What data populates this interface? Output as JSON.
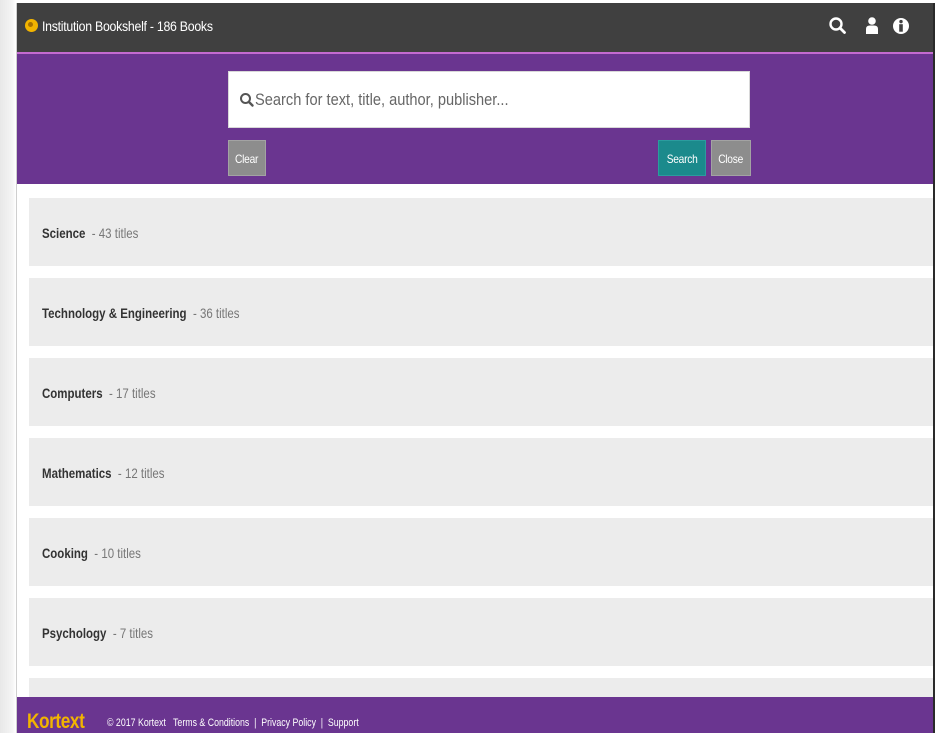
{
  "header": {
    "title": "Institution Bookshelf - 186 Books",
    "icons": [
      "search-icon",
      "user-icon",
      "info-icon"
    ]
  },
  "search": {
    "placeholder": "Search for text, title, author, publisher...",
    "value": "",
    "clear_label": "Clear",
    "search_label": "Search",
    "close_label": "Close"
  },
  "categories": [
    {
      "name": "Science",
      "count": "- 43 titles"
    },
    {
      "name": "Technology & Engineering",
      "count": "- 36 titles"
    },
    {
      "name": "Computers",
      "count": "- 17 titles"
    },
    {
      "name": "Mathematics",
      "count": "- 12 titles"
    },
    {
      "name": "Cooking",
      "count": "- 10 titles"
    },
    {
      "name": "Psychology",
      "count": "- 7 titles"
    }
  ],
  "footer": {
    "brand": "Kortext",
    "copyright": "© 2017 Kortext",
    "terms": "Terms & Conditions",
    "privacy": "Privacy Policy",
    "support": "Support",
    "separator": "|"
  },
  "colors": {
    "topbar": "#404040",
    "brand_purple": "#6a3590",
    "accent_teal": "#1b8a8c",
    "brand_yellow": "#f2b400",
    "category_bg": "#ececec"
  }
}
